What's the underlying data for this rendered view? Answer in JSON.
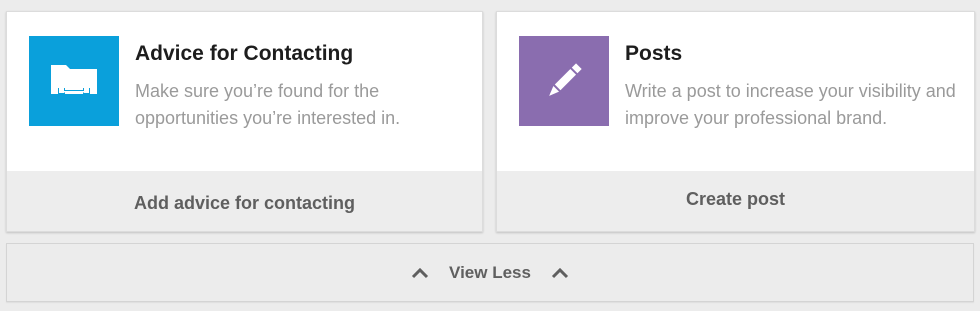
{
  "cards": [
    {
      "title": "Advice for Contacting",
      "description": "Make sure you’re found for the opportunities you’re interested in.",
      "action_label": "Add advice for contacting",
      "icon": "folder-icon",
      "icon_bg": "#0aa0db"
    },
    {
      "title": "Posts",
      "description": "Write a post to increase your visibility and improve your professional brand.",
      "action_label": "Create post",
      "icon": "pencil-icon",
      "icon_bg": "#8a6daf"
    }
  ],
  "view_less": {
    "label": "View Less",
    "icon": "chevron-up-icon"
  }
}
